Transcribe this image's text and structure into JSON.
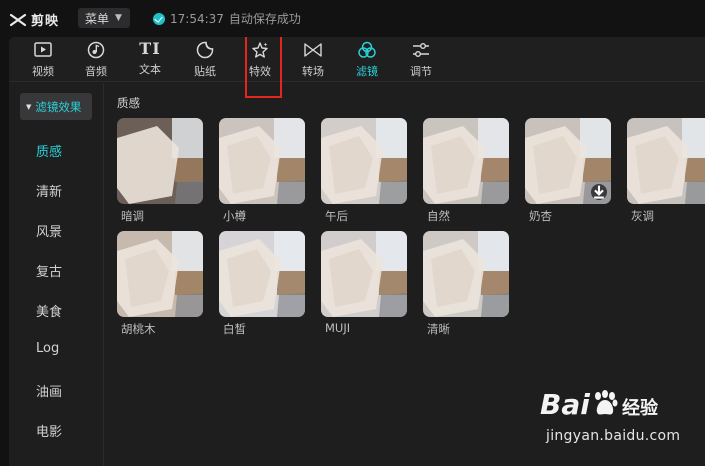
{
  "app": {
    "name": "剪映",
    "menu_label": "菜单",
    "save_time": "17:54:37",
    "save_text": "自动保存成功"
  },
  "toolbar": {
    "items": [
      {
        "label": "视频",
        "icon": "video-play-icon"
      },
      {
        "label": "音频",
        "icon": "music-note-icon"
      },
      {
        "label": "文本",
        "icon": "text-tt-icon",
        "glyph": "TI"
      },
      {
        "label": "贴纸",
        "icon": "sticker-icon"
      },
      {
        "label": "特效",
        "icon": "sparkle-star-icon"
      },
      {
        "label": "转场",
        "icon": "transition-bowtie-icon"
      },
      {
        "label": "滤镜",
        "icon": "filter-circles-icon",
        "active": true
      },
      {
        "label": "调节",
        "icon": "adjust-sliders-icon"
      }
    ],
    "accent_color": "#2ad1d7",
    "highlight_color": "#e5261d"
  },
  "sidebar": {
    "header": "滤镜效果",
    "items": [
      "质感",
      "清新",
      "风景",
      "复古",
      "美食",
      "Log",
      "油画",
      "电影"
    ],
    "active": "质感"
  },
  "content": {
    "section_title": "质感",
    "filters": [
      {
        "label": "暗调"
      },
      {
        "label": "小樽"
      },
      {
        "label": "午后"
      },
      {
        "label": "自然"
      },
      {
        "label": "奶杏",
        "download_icon": "download-icon"
      },
      {
        "label": "灰调"
      },
      {
        "label": "胡桃木"
      },
      {
        "label": "白皙"
      },
      {
        "label": "MUJI"
      },
      {
        "label": "清晰"
      }
    ]
  },
  "watermark": {
    "brand": "Bai",
    "brand_suffix": "经验",
    "url": "jingyan.baidu.com",
    "icon": "baidu-paw-icon"
  }
}
